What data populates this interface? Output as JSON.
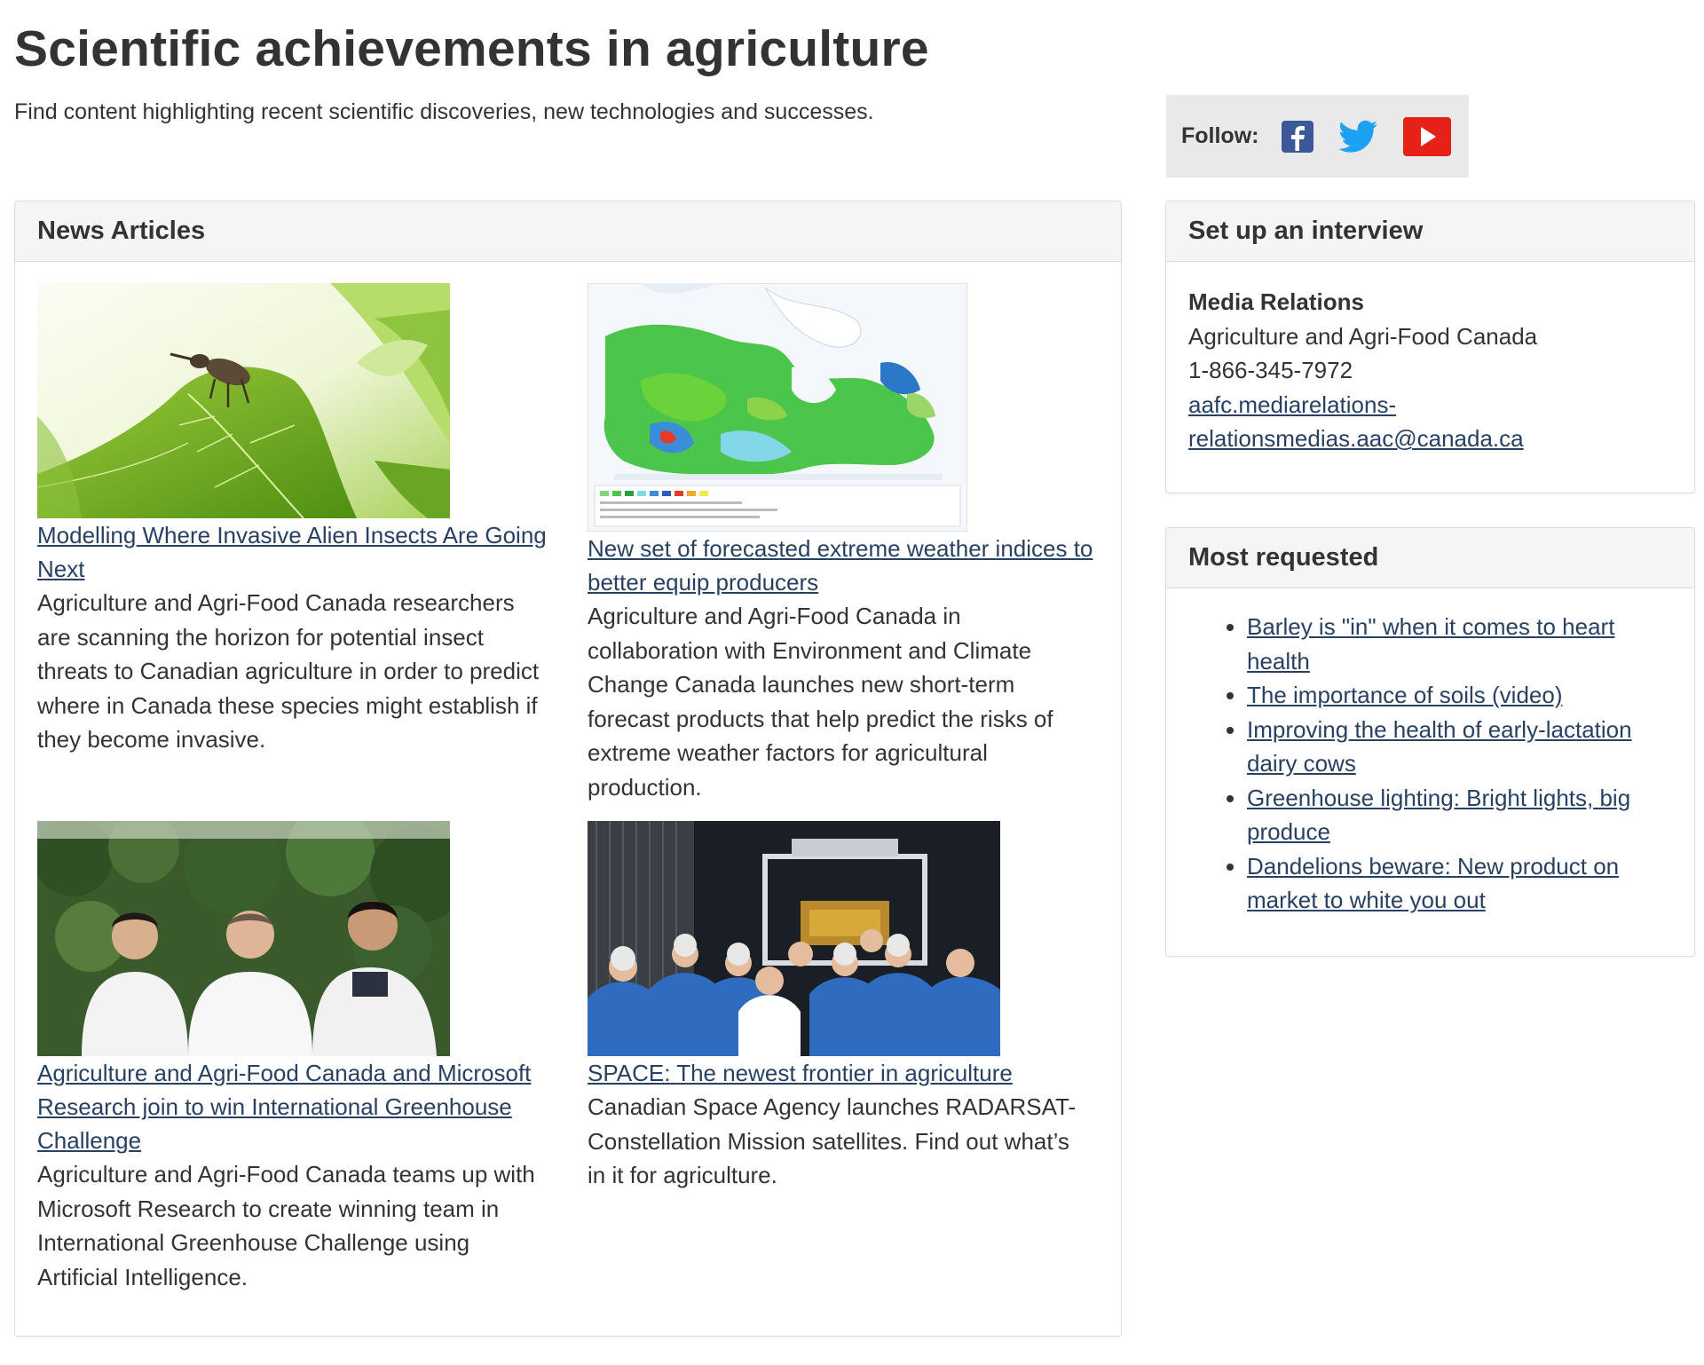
{
  "page": {
    "title": "Scientific achievements in agriculture",
    "intro": "Find content highlighting recent scientific discoveries, new technologies and successes."
  },
  "follow": {
    "label": "Follow:",
    "icons": [
      "facebook-icon",
      "twitter-icon",
      "youtube-icon"
    ],
    "colors": {
      "facebook": "#3b5998",
      "twitter": "#1da1f2",
      "youtube": "#e62117"
    }
  },
  "news": {
    "heading": "News Articles",
    "articles": [
      {
        "title": "Modelling Where Invasive Alien Insects Are Going Next",
        "summary": "Agriculture and Agri-Food Canada researchers are scanning the horizon for potential insect threats to Canadian agriculture in order to predict where in Canada these species might establish if they become invasive."
      },
      {
        "title": "New set of forecasted extreme weather indices to better equip producers",
        "summary": "Agriculture and Agri-Food Canada in collaboration with Environment and Climate Change Canada launches new short-term forecast products that help predict the risks of extreme weather factors for agricultural production."
      },
      {
        "title": "Agriculture and Agri-Food Canada and Microsoft Research join to win International Greenhouse Challenge",
        "summary": "Agriculture and Agri-Food Canada teams up with Microsoft Research to create winning team in International Greenhouse Challenge using Artificial Intelligence."
      },
      {
        "title": "SPACE: The newest frontier in agriculture",
        "summary": "Canadian Space Agency launches RADARSAT-Constellation Mission satellites. Find out what’s in it for agriculture."
      }
    ]
  },
  "interview": {
    "heading": "Set up an interview",
    "org": "Media Relations",
    "dept": "Agriculture and Agri-Food Canada",
    "phone": "1-866-345-7972",
    "email_line1": "aafc.mediarelations-",
    "email_line2": "relationsmedias.aac@canada.ca"
  },
  "most_requested": {
    "heading": "Most requested",
    "items": [
      {
        "label": "Barley is \"in\" when it comes to heart health"
      },
      {
        "label": "The importance of soils (video)"
      },
      {
        "label": "Improving the health of early-lactation dairy cows"
      },
      {
        "label": "Greenhouse lighting: Bright lights, big produce"
      },
      {
        "label": "Dandelions beware: New product on market to white you out"
      }
    ]
  },
  "theme": {
    "link": "#284162",
    "text": "#333333",
    "panel_heading_bg": "#f5f5f5"
  }
}
